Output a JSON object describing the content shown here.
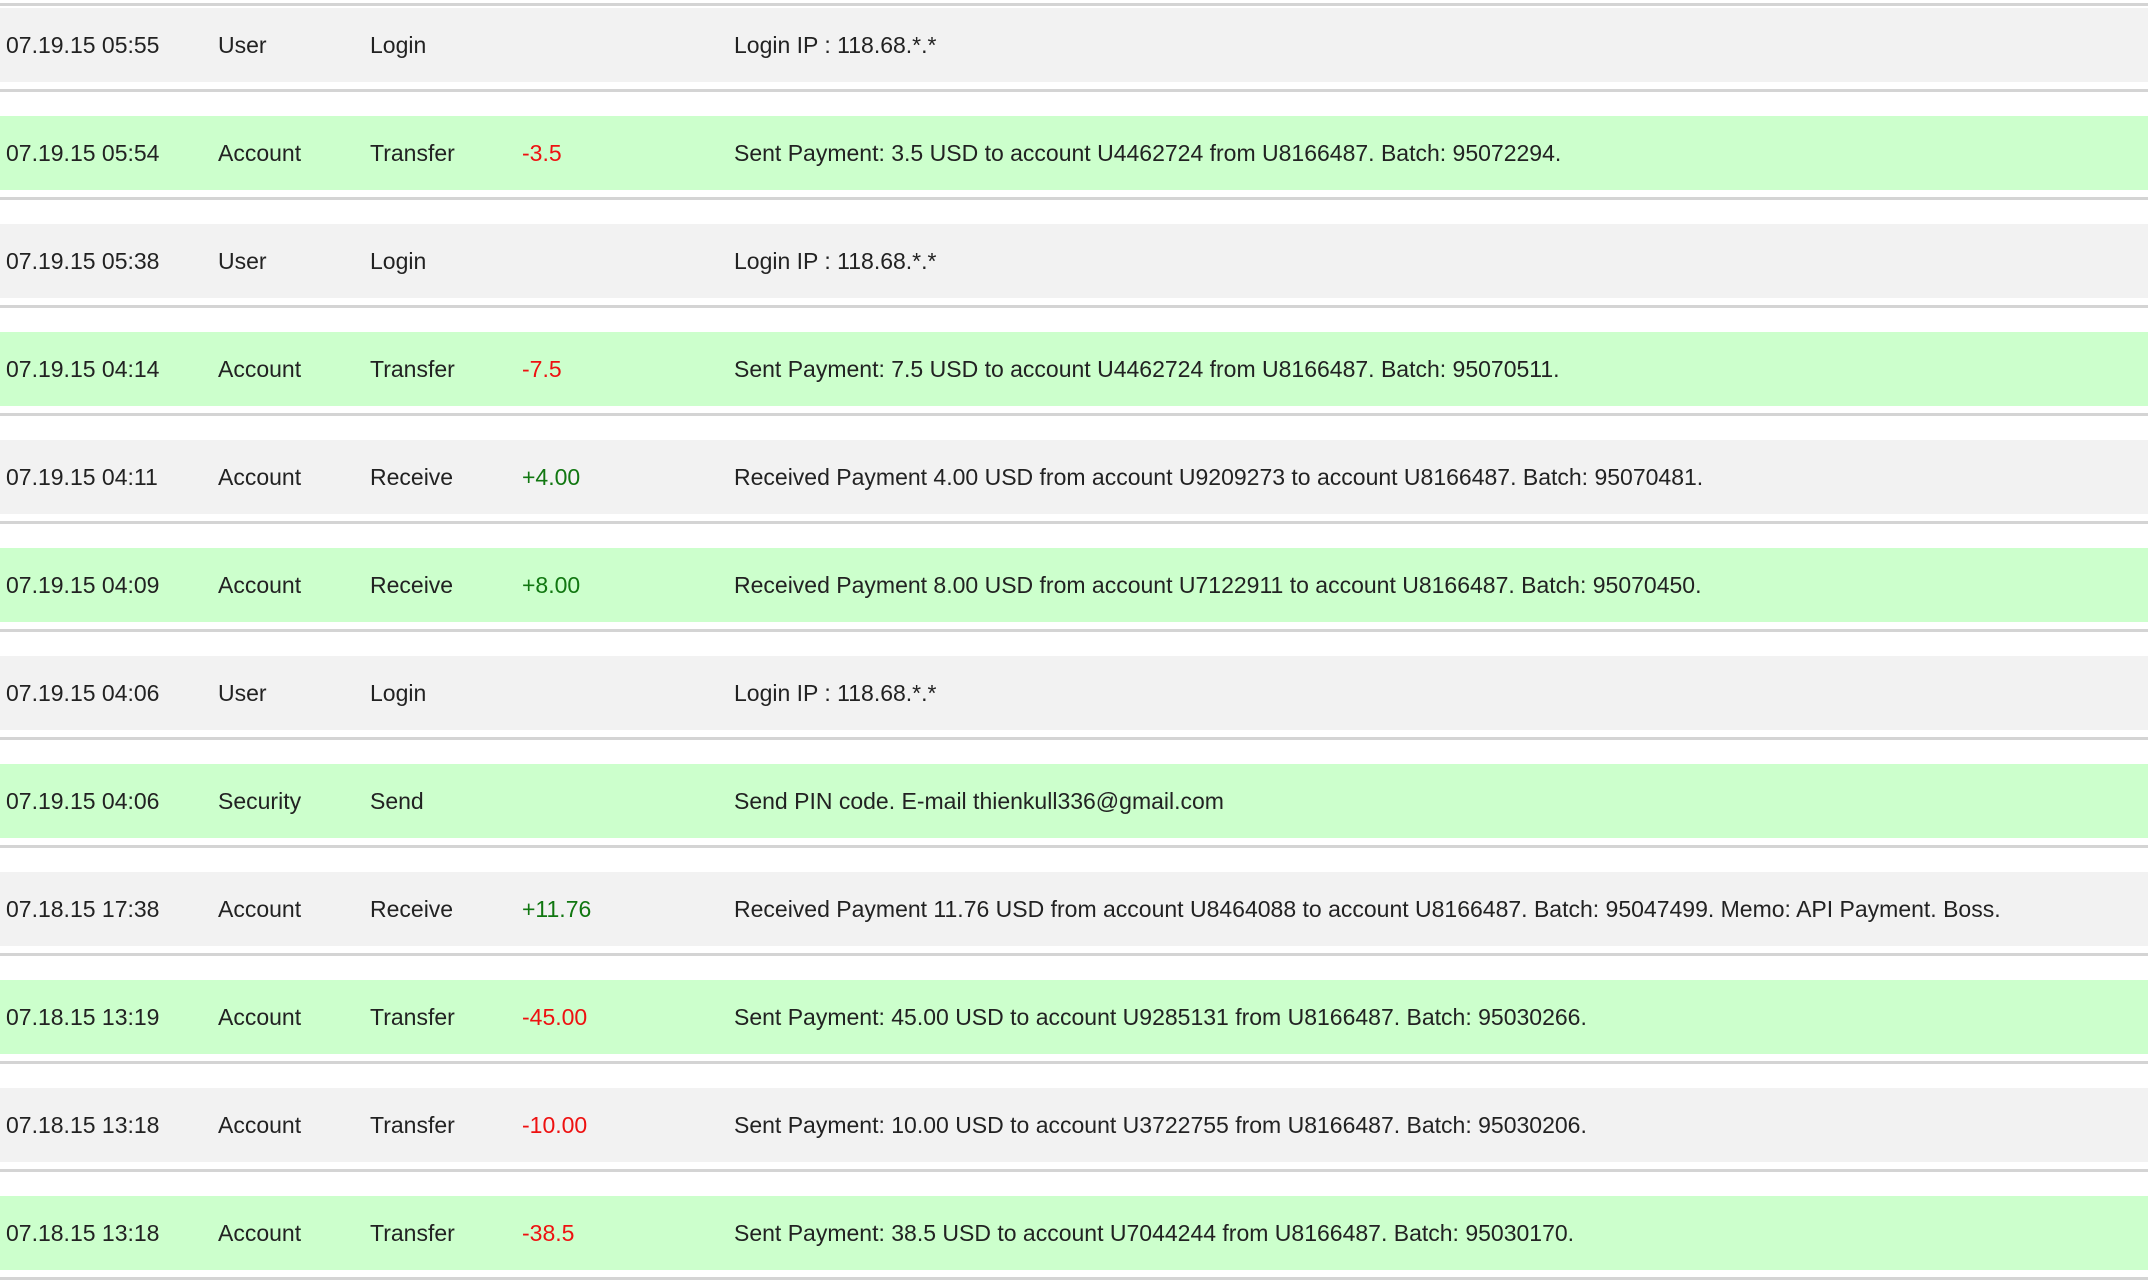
{
  "colors": {
    "row_gray": "#f2f2f2",
    "row_green": "#ccffcc",
    "separator": "#d4d4d4",
    "amount_negative": "#ee1111",
    "amount_positive": "#117711"
  },
  "rows": [
    {
      "date": "07.19.15 05:55",
      "category": "User",
      "type": "Login",
      "amount": "",
      "description": "Login IP : 118.68.*.*",
      "style": "gray"
    },
    {
      "date": "07.19.15 05:54",
      "category": "Account",
      "type": "Transfer",
      "amount": "-3.5",
      "description": "Sent Payment: 3.5 USD to account U4462724 from U8166487. Batch: 95072294.",
      "style": "green"
    },
    {
      "date": "07.19.15 05:38",
      "category": "User",
      "type": "Login",
      "amount": "",
      "description": "Login IP : 118.68.*.*",
      "style": "gray"
    },
    {
      "date": "07.19.15 04:14",
      "category": "Account",
      "type": "Transfer",
      "amount": "-7.5",
      "description": "Sent Payment: 7.5 USD to account U4462724 from U8166487. Batch: 95070511.",
      "style": "green"
    },
    {
      "date": "07.19.15 04:11",
      "category": "Account",
      "type": "Receive",
      "amount": "+4.00",
      "description": "Received Payment 4.00 USD from account U9209273 to account U8166487. Batch: 95070481.",
      "style": "gray"
    },
    {
      "date": "07.19.15 04:09",
      "category": "Account",
      "type": "Receive",
      "amount": "+8.00",
      "description": "Received Payment 8.00 USD from account U7122911 to account U8166487. Batch: 95070450.",
      "style": "green"
    },
    {
      "date": "07.19.15 04:06",
      "category": "User",
      "type": "Login",
      "amount": "",
      "description": "Login IP : 118.68.*.*",
      "style": "gray"
    },
    {
      "date": "07.19.15 04:06",
      "category": "Security",
      "type": "Send",
      "amount": "",
      "description": "Send PIN code. E-mail thienkull336@gmail.com",
      "style": "green"
    },
    {
      "date": "07.18.15 17:38",
      "category": "Account",
      "type": "Receive",
      "amount": "+11.76",
      "description": "Received Payment 11.76 USD from account U8464088 to account U8166487. Batch: 95047499. Memo: API Payment. Boss.",
      "style": "gray"
    },
    {
      "date": "07.18.15 13:19",
      "category": "Account",
      "type": "Transfer",
      "amount": "-45.00",
      "description": "Sent Payment: 45.00 USD to account U9285131 from U8166487. Batch: 95030266.",
      "style": "green"
    },
    {
      "date": "07.18.15 13:18",
      "category": "Account",
      "type": "Transfer",
      "amount": "-10.00",
      "description": "Sent Payment: 10.00 USD to account U3722755 from U8166487. Batch: 95030206.",
      "style": "gray"
    },
    {
      "date": "07.18.15 13:18",
      "category": "Account",
      "type": "Transfer",
      "amount": "-38.5",
      "description": "Sent Payment: 38.5 USD to account U7044244 from U8166487. Batch: 95030170.",
      "style": "green"
    }
  ]
}
